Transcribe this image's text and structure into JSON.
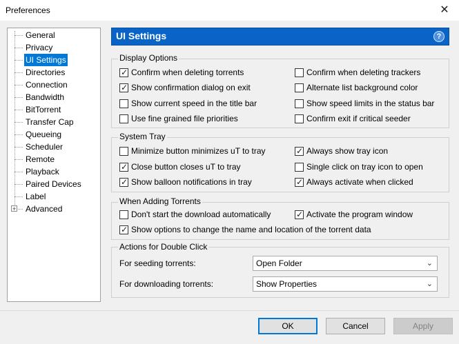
{
  "window": {
    "title": "Preferences",
    "close_glyph": "✕"
  },
  "tree": {
    "items": [
      {
        "label": "General"
      },
      {
        "label": "Privacy"
      },
      {
        "label": "UI Settings",
        "selected": true
      },
      {
        "label": "Directories"
      },
      {
        "label": "Connection"
      },
      {
        "label": "Bandwidth"
      },
      {
        "label": "BitTorrent"
      },
      {
        "label": "Transfer Cap"
      },
      {
        "label": "Queueing"
      },
      {
        "label": "Scheduler"
      },
      {
        "label": "Remote"
      },
      {
        "label": "Playback"
      },
      {
        "label": "Paired Devices"
      },
      {
        "label": "Label"
      },
      {
        "label": "Advanced",
        "expandable": true
      }
    ],
    "expander_glyph": "+"
  },
  "header": {
    "title": "UI Settings",
    "help_glyph": "?"
  },
  "display_options": {
    "title": "Display Options",
    "items": [
      {
        "label": "Confirm when deleting torrents",
        "checked": true
      },
      {
        "label": "Confirm when deleting trackers",
        "checked": false
      },
      {
        "label": "Show confirmation dialog on exit",
        "checked": true
      },
      {
        "label": "Alternate list background color",
        "checked": false
      },
      {
        "label": "Show current speed in the title bar",
        "checked": false
      },
      {
        "label": "Show speed limits in the status bar",
        "checked": false
      },
      {
        "label": "Use fine grained file priorities",
        "checked": false
      },
      {
        "label": "Confirm exit if critical seeder",
        "checked": false
      }
    ]
  },
  "system_tray": {
    "title": "System Tray",
    "items": [
      {
        "label": "Minimize button minimizes uT to tray",
        "checked": false
      },
      {
        "label": "Always show tray icon",
        "checked": true
      },
      {
        "label": "Close button closes uT to tray",
        "checked": true
      },
      {
        "label": "Single click on tray icon to open",
        "checked": false
      },
      {
        "label": "Show balloon notifications in tray",
        "checked": true
      },
      {
        "label": "Always activate when clicked",
        "checked": true
      }
    ]
  },
  "adding_torrents": {
    "title": "When Adding Torrents",
    "items": [
      {
        "label": "Don't start the download automatically",
        "checked": false
      },
      {
        "label": "Activate the program window",
        "checked": true
      },
      {
        "label": "Show options to change the name and location of the torrent data",
        "checked": true
      }
    ]
  },
  "double_click": {
    "title": "Actions for Double Click",
    "seeding_label": "For seeding torrents:",
    "seeding_value": "Open Folder",
    "downloading_label": "For downloading torrents:",
    "downloading_value": "Show Properties",
    "chevron_glyph": "⌄"
  },
  "check_glyph": "✓",
  "buttons": {
    "ok": "OK",
    "cancel": "Cancel",
    "apply": "Apply"
  }
}
